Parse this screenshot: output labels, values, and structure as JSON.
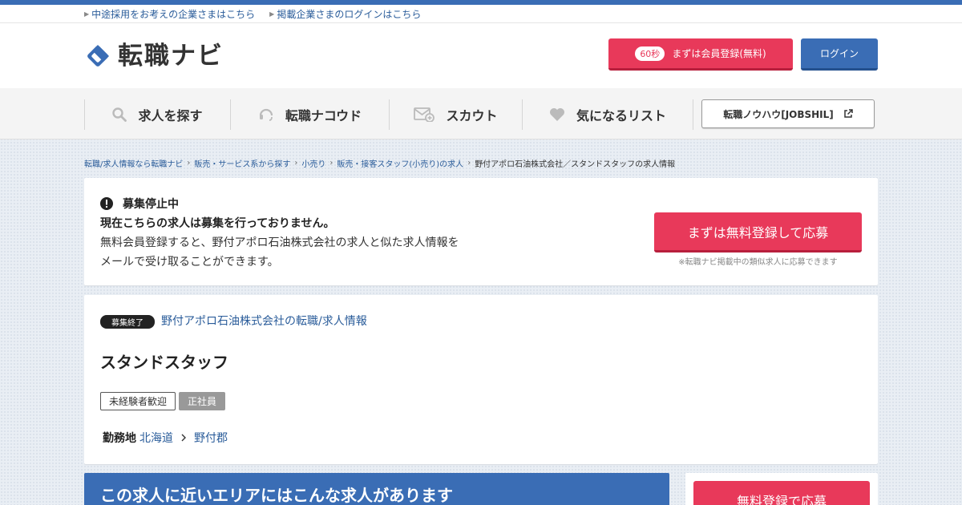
{
  "utility_links": [
    "中途採用をお考えの企業さまはこちら",
    "掲載企業さまのログインはこちら"
  ],
  "header": {
    "logo_text": "転職ナビ",
    "register_badge": "60秒",
    "register_label": "まずは会員登録(無料)",
    "login_label": "ログイン"
  },
  "nav": {
    "items": [
      {
        "label": "求人を探す",
        "icon": "search-icon"
      },
      {
        "label": "転職ナコウド",
        "icon": "headset-icon"
      },
      {
        "label": "スカウト",
        "icon": "mail-plus-icon"
      },
      {
        "label": "気になるリスト",
        "icon": "heart-icon"
      }
    ],
    "external_label": "転職ノウハウ[JOBSHIL]"
  },
  "breadcrumb": [
    "転職/求人情報なら転職ナビ",
    "販売・サービス系から探す",
    "小売り",
    "販売・接客スタッフ(小売り)の求人",
    "野付アポロ石油株式会社／スタンドスタッフの求人情報"
  ],
  "notice": {
    "status": "募集停止中",
    "headline": "現在こちらの求人は募集を行っておりません。",
    "line1": "無料会員登録すると、野付アポロ石油株式会社の求人と似た求人情報を",
    "line2": "メールで受け取ることができます。",
    "apply_label": "まずは無料登録して応募",
    "apply_note": "※転職ナビ掲載中の類似求人に応募できます"
  },
  "job": {
    "end_badge": "募集終了",
    "company_link": "野付アポロ石油株式会社の転職/求人情報",
    "title": "スタンドスタッフ",
    "tags": [
      "未経験者歓迎",
      "正社員"
    ],
    "location_label": "勤務地",
    "location_pref": "北海道",
    "location_city": "野付郡"
  },
  "near_banner": "この求人に近いエリアにはこんな求人があります",
  "side_apply": "無料登録で応募",
  "colors": {
    "brand_blue": "#3a6db5",
    "accent_red": "#e8395a",
    "link": "#2a5c9a"
  }
}
